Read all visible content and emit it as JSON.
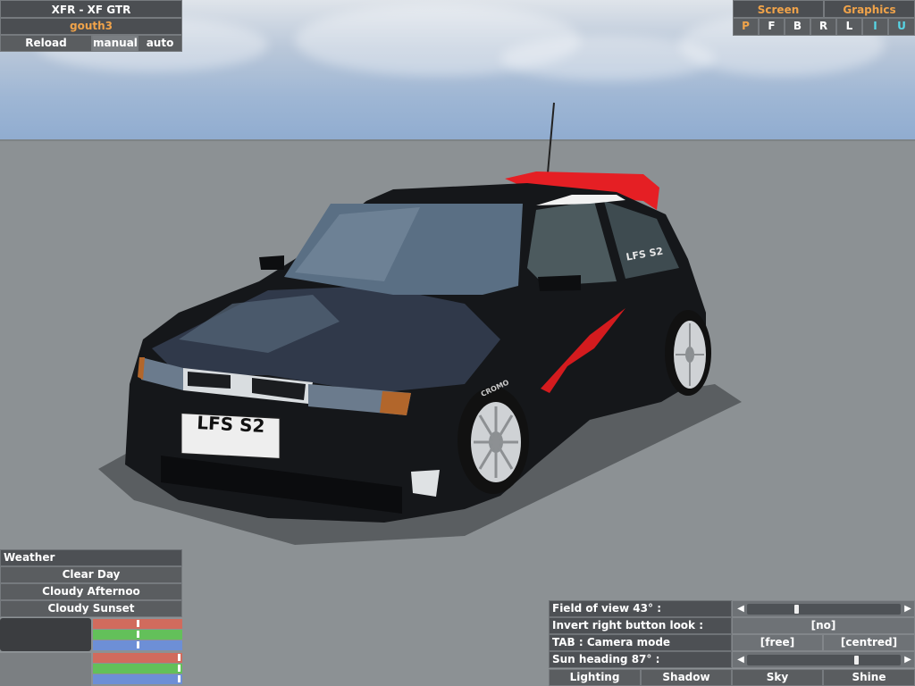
{
  "car": {
    "title": "XFR - XF GTR",
    "skin": "gouth3",
    "reload_label": "Reload",
    "manual_label": "manual",
    "auto_label": "auto",
    "plate_text": "LFS S2",
    "window_decal": "LFS S2",
    "tyre_brand": "CROMO"
  },
  "top_right": {
    "screen_label": "Screen",
    "graphics_label": "Graphics",
    "buttons": [
      "P",
      "F",
      "B",
      "R",
      "L",
      "I",
      "U"
    ]
  },
  "weather": {
    "header": "Weather",
    "options": [
      "Clear Day",
      "Cloudy Afternoo",
      "Cloudy Sunset"
    ],
    "color_bars_top": [
      {
        "color": "#d16b5d",
        "value": 0.5
      },
      {
        "color": "#63c05a",
        "value": 0.5
      },
      {
        "color": "#6d8fd6",
        "value": 0.5
      }
    ],
    "color_bars_bottom": [
      {
        "color": "#d16b5d",
        "value": 0.98
      },
      {
        "color": "#63c05a",
        "value": 0.98
      },
      {
        "color": "#6d8fd6",
        "value": 0.98
      }
    ]
  },
  "settings": {
    "fov_label": "Field of view 43° :",
    "fov_value": 0.32,
    "invert_label": "Invert right button look :",
    "invert_value": "[no]",
    "tab_label": "TAB : Camera mode",
    "camera_free": "[free]",
    "camera_centred": "[centred]",
    "sun_label": "Sun heading 87° :",
    "sun_value": 0.72,
    "bottom_tabs": [
      "Lighting",
      "Shadow",
      "Sky",
      "Shine"
    ],
    "arrow_left": "◀",
    "arrow_right": "▶"
  },
  "colors": {
    "accent_orange": "#f0a34a",
    "accent_cyan": "#57d6e6",
    "panel": "#5a5d60"
  }
}
